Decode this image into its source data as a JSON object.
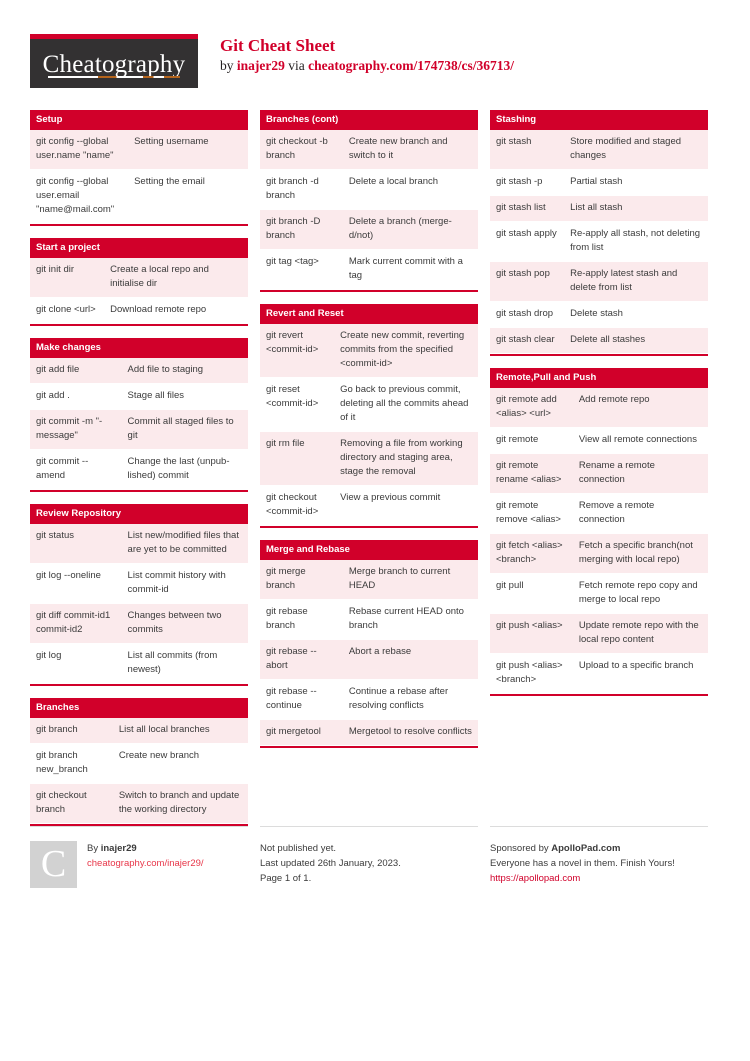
{
  "header": {
    "logo_text": "Cheatography",
    "title": "Git Cheat Sheet",
    "byline_prefix": "by ",
    "author": "inajer29",
    "byline_via": " via ",
    "source_url": "cheatography.com/174738/cs/36713/"
  },
  "columns": [
    {
      "tables": [
        {
          "title": "Setup",
          "key_width": "k45",
          "rows": [
            {
              "k": "git config --global user.name \"name\"",
              "v": "Setting username"
            },
            {
              "k": "git config --global user.email \"name@mail.com\"",
              "v": "Setting the email"
            }
          ]
        },
        {
          "title": "Start a project",
          "key_width": "k34",
          "rows": [
            {
              "k": "git init dir",
              "v": "Create a local repo and initialise dir"
            },
            {
              "k": "git clone <url>",
              "v": "Download remote repo"
            }
          ]
        },
        {
          "title": "Make changes",
          "key_width": "k42",
          "rows": [
            {
              "k": "git add file",
              "v": "Add file to staging"
            },
            {
              "k": "git add .",
              "v": "Stage all files"
            },
            {
              "k": "git commit -m \"-message\"",
              "v": "Commit all staged files to git"
            },
            {
              "k": "git commit --amend",
              "v": "Change the last (unpub­lished) commit"
            }
          ]
        },
        {
          "title": "Review Repository",
          "key_width": "k42",
          "rows": [
            {
              "k": "git status",
              "v": "List new/modified files that are yet to be committed"
            },
            {
              "k": "git log --oneline",
              "v": "List commit history with commit-id"
            },
            {
              "k": "git diff commit-id1 commit-id2",
              "v": "Changes between two commits"
            },
            {
              "k": "git log",
              "v": "List all commits (from newest)"
            }
          ]
        },
        {
          "title": "Branches",
          "key_width": "k38",
          "rows": [
            {
              "k": "git branch",
              "v": "List all local branches"
            },
            {
              "k": "git branch new_branch",
              "v": "Create new branch"
            },
            {
              "k": "git checkout branch",
              "v": "Switch to branch and update the working directory"
            }
          ]
        }
      ]
    },
    {
      "tables": [
        {
          "title": "Branches (cont)",
          "key_width": "k38",
          "rows": [
            {
              "k": "git checkout -b branch",
              "v": "Create new branch and switch to it"
            },
            {
              "k": "git branch -d branch",
              "v": "Delete a local branch"
            },
            {
              "k": "git branch -D branch",
              "v": "Delete a branch (merge­d/not)"
            },
            {
              "k": "git tag <tag>",
              "v": "Mark current commit with a tag"
            }
          ]
        },
        {
          "title": "Revert and Reset",
          "key_width": "k34",
          "rows": [
            {
              "k": "git revert <commit-id>",
              "v": "Create new commit, reverting commits from the specified <commit-id>"
            },
            {
              "k": "git reset <commit-id>",
              "v": "Go back to previous commit, deleting all the commits ahead of it"
            },
            {
              "k": "git rm file",
              "v": "Removing a file from working directory and staging area, stage the removal"
            },
            {
              "k": "git checkout <commit-id>",
              "v": "View a previous commit"
            }
          ]
        },
        {
          "title": "Merge and Rebase",
          "key_width": "k38",
          "rows": [
            {
              "k": "git merge branch",
              "v": "Merge branch to current HEAD"
            },
            {
              "k": "git rebase branch",
              "v": "Rebase current HEAD onto branch"
            },
            {
              "k": "git rebase --abort",
              "v": "Abort a rebase"
            },
            {
              "k": "git rebase --continue",
              "v": "Continue a rebase after resolving conflicts"
            },
            {
              "k": "git mergetool",
              "v": "Mergetool to resolve conflicts"
            }
          ]
        }
      ]
    },
    {
      "tables": [
        {
          "title": "Stashing",
          "key_width": "k34",
          "rows": [
            {
              "k": "git stash",
              "v": "Store modified and staged changes"
            },
            {
              "k": "git stash -p",
              "v": "Partial stash"
            },
            {
              "k": "git stash list",
              "v": "List all stash"
            },
            {
              "k": "git stash apply",
              "v": "Re-apply all stash, not deleting from list"
            },
            {
              "k": "git stash pop",
              "v": "Re-apply latest stash and delete from list"
            },
            {
              "k": "git stash drop",
              "v": "Delete stash"
            },
            {
              "k": "git stash clear",
              "v": "Delete all stashes"
            }
          ]
        },
        {
          "title": "Remote,Pull and Push",
          "key_width": "k38",
          "rows": [
            {
              "k": "git remote add <alias> <url>",
              "v": "Add remote repo"
            },
            {
              "k": "git remote",
              "v": "View all remote connec­tions"
            },
            {
              "k": "git remote rename <al­ias>",
              "v": "Rename a remote connection"
            },
            {
              "k": "git remote remove <al­ias>",
              "v": "Remove a remote connection"
            },
            {
              "k": "git fetch <al­ias> <branc­h>",
              "v": "Fetch a specific branch(not merging with local repo)"
            },
            {
              "k": "git pull",
              "v": "Fetch remote repo copy and merge to local repo"
            },
            {
              "k": "git push <al­ias>",
              "v": "Update remote repo with the local repo content"
            },
            {
              "k": "git push <al­ias> <branc­h>",
              "v": "Upload to a specific branch"
            }
          ]
        }
      ]
    }
  ],
  "footer": {
    "author_block": {
      "avatar_letter": "C",
      "by_prefix": "By ",
      "author": "inajer29",
      "profile_url": "cheatography.com/inajer29/"
    },
    "publish_block": {
      "line1": "Not published yet.",
      "line2": "Last updated 26th January, 2023.",
      "line3": "Page 1 of 1."
    },
    "sponsor_block": {
      "prefix": "Sponsored by ",
      "sponsor": "ApolloPad.com",
      "tagline": "Everyone has a novel in them. Finish Yours!",
      "url": "https://apollopad.com"
    }
  },
  "colors": {
    "brand_red": "#d1002a",
    "row_tint": "#fbeaec",
    "logo_bg": "#333132",
    "link_red": "#e8374a"
  }
}
